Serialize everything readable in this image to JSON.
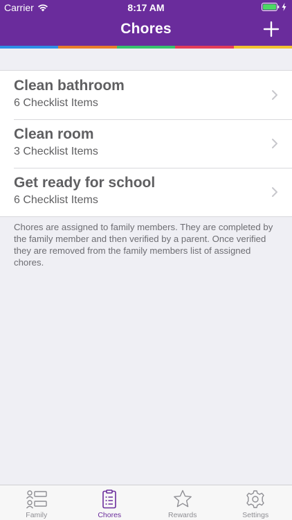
{
  "status_bar": {
    "carrier": "Carrier",
    "time": "8:17 AM"
  },
  "nav": {
    "title": "Chores"
  },
  "colors": {
    "brand": "#6a2c9c",
    "rainbow": [
      "#2f8ee6",
      "#e87d2c",
      "#37c16d",
      "#e43d5a",
      "#f2c230"
    ]
  },
  "chores": [
    {
      "title": "Clean bathroom",
      "subtitle": "6 Checklist Items"
    },
    {
      "title": "Clean room",
      "subtitle": "3 Checklist Items"
    },
    {
      "title": "Get ready for school",
      "subtitle": "6 Checklist Items"
    }
  ],
  "footer_note": "Chores are assigned to family members. They are completed by the family member and then verified by a parent. Once verified they are removed from the family members list of assigned chores.",
  "tabs": [
    {
      "label": "Family",
      "icon": "family-icon",
      "active": false
    },
    {
      "label": "Chores",
      "icon": "chores-clipboard-icon",
      "active": true
    },
    {
      "label": "Rewards",
      "icon": "star-icon",
      "active": false
    },
    {
      "label": "Settings",
      "icon": "gear-icon",
      "active": false
    }
  ]
}
